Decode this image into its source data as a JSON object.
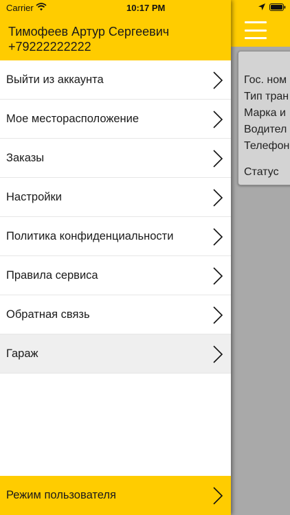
{
  "status_bar": {
    "carrier": "Carrier",
    "time": "10:17 PM",
    "wifi_icon": "wifi-icon",
    "location_icon": "location-arrow-icon",
    "battery_icon": "battery-icon"
  },
  "colors": {
    "accent": "#ffcc00",
    "overlay_gray": "#a9a9a9",
    "selected_row": "#efefef",
    "text": "#1a1a1a"
  },
  "drawer": {
    "user_name": "Тимофеев Артур Сергеевич",
    "user_phone": "+79222222222",
    "menu_items": [
      {
        "label": "Выйти из аккаунта"
      },
      {
        "label": "Мое месторасположение"
      },
      {
        "label": "Заказы"
      },
      {
        "label": "Настройки"
      },
      {
        "label": "Политика конфиденциальности"
      },
      {
        "label": "Правила сервиса"
      },
      {
        "label": "Обратная связь"
      },
      {
        "label": "Гараж",
        "selected": true
      }
    ],
    "mode_button_label": "Режим пользователя"
  },
  "background_screen": {
    "menu_icon": "hamburger-menu-icon",
    "info_card": {
      "lines": [
        "Гос. ном",
        "Тип тран",
        "Марка и",
        "Водител",
        "Телефон"
      ],
      "status": "Статус"
    }
  }
}
